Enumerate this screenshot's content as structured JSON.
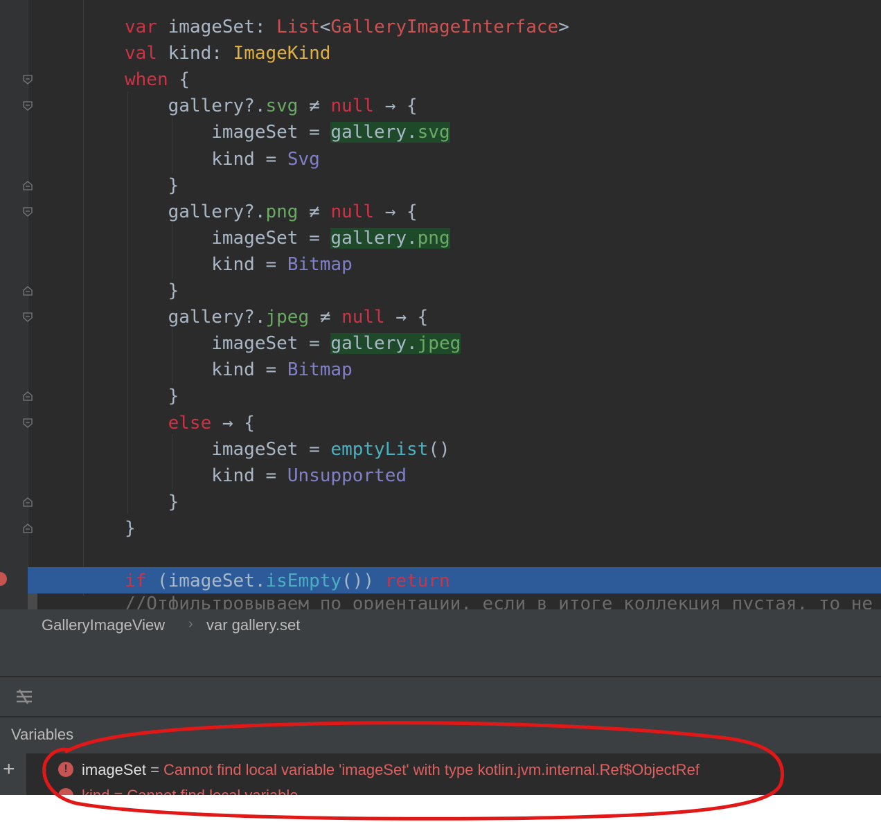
{
  "editor": {
    "lines": [
      [
        {
          "t": "var",
          "c": "kw"
        },
        {
          "t": " imageSet: "
        },
        {
          "t": "List",
          "c": "gn"
        },
        {
          "t": "<"
        },
        {
          "t": "GalleryImageInterface",
          "c": "gn"
        },
        {
          "t": ">"
        }
      ],
      [
        {
          "t": "val",
          "c": "kw"
        },
        {
          "t": " kind: "
        },
        {
          "t": "ImageKind",
          "c": "ty"
        }
      ],
      [
        {
          "t": "when",
          "c": "kw"
        },
        {
          "t": " {"
        }
      ],
      [
        {
          "t": "    gallery?."
        },
        {
          "t": "svg",
          "c": "pr"
        },
        {
          "t": " ≠ "
        },
        {
          "t": "null",
          "c": "kw"
        },
        {
          "t": " → {"
        }
      ],
      [
        {
          "t": "        imageSet = "
        },
        {
          "t": "gallery.",
          "c": "hl"
        },
        {
          "t": "svg",
          "c": "pr hl"
        }
      ],
      [
        {
          "t": "        kind = "
        },
        {
          "t": "Svg",
          "c": "en"
        }
      ],
      [
        {
          "t": "    }"
        }
      ],
      [
        {
          "t": "    gallery?."
        },
        {
          "t": "png",
          "c": "pr"
        },
        {
          "t": " ≠ "
        },
        {
          "t": "null",
          "c": "kw"
        },
        {
          "t": " → {"
        }
      ],
      [
        {
          "t": "        imageSet = "
        },
        {
          "t": "gallery.",
          "c": "hl"
        },
        {
          "t": "png",
          "c": "pr hl"
        }
      ],
      [
        {
          "t": "        kind = "
        },
        {
          "t": "Bitmap",
          "c": "en"
        }
      ],
      [
        {
          "t": "    }"
        }
      ],
      [
        {
          "t": "    gallery?."
        },
        {
          "t": "jpeg",
          "c": "pr"
        },
        {
          "t": " ≠ "
        },
        {
          "t": "null",
          "c": "kw"
        },
        {
          "t": " → {"
        }
      ],
      [
        {
          "t": "        imageSet = "
        },
        {
          "t": "gallery.",
          "c": "hl"
        },
        {
          "t": "jpeg",
          "c": "pr hl"
        }
      ],
      [
        {
          "t": "        kind = "
        },
        {
          "t": "Bitmap",
          "c": "en"
        }
      ],
      [
        {
          "t": "    }"
        }
      ],
      [
        {
          "t": "    "
        },
        {
          "t": "else",
          "c": "kw"
        },
        {
          "t": " → {"
        }
      ],
      [
        {
          "t": "        imageSet = "
        },
        {
          "t": "emptyList",
          "c": "fn"
        },
        {
          "t": "()"
        }
      ],
      [
        {
          "t": "        kind = "
        },
        {
          "t": "Unsupported",
          "c": "en"
        }
      ],
      [
        {
          "t": "    }"
        }
      ],
      [
        {
          "t": "}"
        }
      ],
      [
        {
          "t": ""
        }
      ],
      [
        {
          "t": "if",
          "c": "kw"
        },
        {
          "t": " (imageSet."
        },
        {
          "t": "isEmpty",
          "c": "fn"
        },
        {
          "t": "()) "
        },
        {
          "t": "return",
          "c": "kw"
        }
      ]
    ],
    "comment_line": "//Отфильтровываем по ориентации, если в итоге коллекция пустая, то не"
  },
  "breadcrumbs": {
    "class_name": "GalleryImageView",
    "separator": "›",
    "member": "var gallery.set"
  },
  "variables_panel": {
    "title": "Variables",
    "add_symbol": "+",
    "error_symbol": "!",
    "rows": [
      {
        "name": "imageSet",
        "equals": " = ",
        "message": "Cannot find local variable 'imageSet' with type kotlin.jvm.internal.Ref$ObjectRef"
      }
    ],
    "partial_row_text": "kind = Cannot find local variable"
  },
  "colors": {
    "editor_bg": "#2b2b2b",
    "caret_line": "#2d5b9a",
    "error": "#e06060",
    "annotation": "#e01818"
  }
}
